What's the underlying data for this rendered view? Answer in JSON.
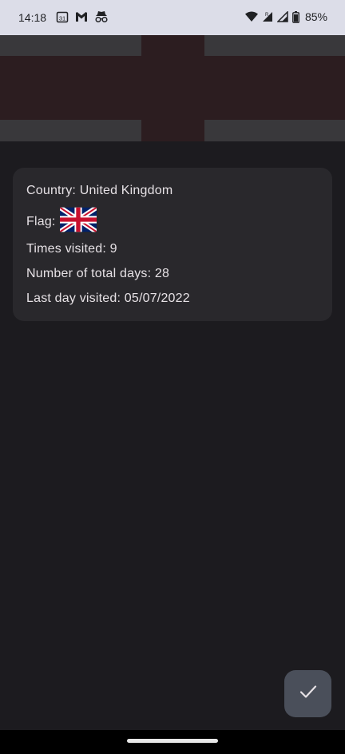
{
  "status_bar": {
    "time": "14:18",
    "calendar_day": "31",
    "battery_percent": "85%",
    "icons": [
      "calendar-icon",
      "gmail-icon",
      "incognito-icon",
      "wifi-icon",
      "signal-r-icon",
      "signal-icon",
      "battery-icon"
    ]
  },
  "banner": {
    "flag": "england-flag",
    "colors": {
      "field": "#39383b",
      "cross": "#2c1d20"
    }
  },
  "card": {
    "country_line": "Country: United Kingdom",
    "flag_label": "Flag:",
    "flag_icon": "union-jack-flag-icon",
    "times_visited_line": "Times visited: 9",
    "total_days_line": "Number of total days: 28",
    "last_visited_line": "Last day visited: 05/07/2022"
  },
  "fab": {
    "icon": "check-icon"
  },
  "colors": {
    "background": "#1c1b1f",
    "card": "#29282c",
    "text": "#e6e1e5",
    "fab": "#4a4f5a",
    "status_bar": "#dcdde8"
  }
}
